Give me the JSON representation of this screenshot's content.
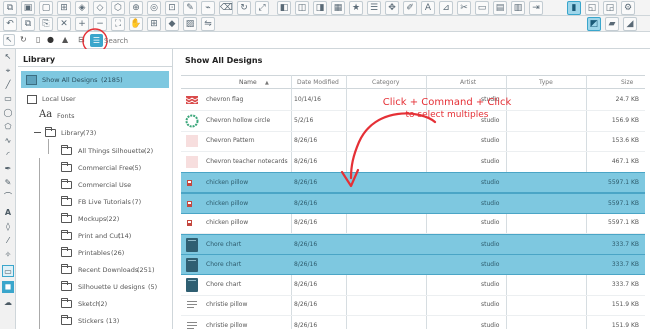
{
  "search": {
    "placeholder": "Search"
  },
  "library": {
    "title": "Library",
    "items": [
      {
        "label": "Show All Designs",
        "count": "(2185)"
      },
      {
        "label": "Local User",
        "count": ""
      },
      {
        "label": "Fonts",
        "count": ""
      },
      {
        "label": "Library",
        "count": "(73)"
      },
      {
        "label": "All Things Silhouette",
        "count": "(2)"
      },
      {
        "label": "Commercial Free",
        "count": "(5)"
      },
      {
        "label": "Commercial Use",
        "count": ""
      },
      {
        "label": "FB Live Tutorials",
        "count": "(7)"
      },
      {
        "label": "Mockups",
        "count": "(22)"
      },
      {
        "label": "Print and Cut",
        "count": "(14)"
      },
      {
        "label": "Printables",
        "count": "(26)"
      },
      {
        "label": "Recent Downloads",
        "count": "(251)"
      },
      {
        "label": "Silhouette U designs",
        "count": "(5)"
      },
      {
        "label": "Sketch",
        "count": "(2)"
      },
      {
        "label": "Stickers",
        "count": "(13)"
      }
    ]
  },
  "designs": {
    "title": "Show All Designs",
    "columns": [
      "Name",
      "Date Modified",
      "Category",
      "Artist",
      "Type",
      "Size"
    ],
    "rows": [
      {
        "name": "chevron flag",
        "date": "10/14/16",
        "type": "studio",
        "size": "24.7 KB",
        "selected": false,
        "thumb": "flag"
      },
      {
        "name": "Chevron hollow circle",
        "date": "5/2/16",
        "type": "studio",
        "size": "156.9 KB",
        "selected": false,
        "thumb": "circle"
      },
      {
        "name": "Chevron Pattern",
        "date": "8/26/16",
        "type": "studio",
        "size": "153.6 KB",
        "selected": false,
        "thumb": "blank"
      },
      {
        "name": "Chevron teacher notecards",
        "date": "8/26/16",
        "type": "studio",
        "size": "467.1 KB",
        "selected": false,
        "thumb": "blank"
      },
      {
        "name": "chicken pillow",
        "date": "8/26/16",
        "type": "studio",
        "size": "5597.1 KB",
        "selected": true,
        "thumb": "pillow"
      },
      {
        "name": "chicken pillow",
        "date": "8/26/16",
        "type": "studio",
        "size": "5597.1 KB",
        "selected": true,
        "thumb": "pillow"
      },
      {
        "name": "chicken pillow",
        "date": "8/26/16",
        "type": "studio",
        "size": "5597.1 KB",
        "selected": false,
        "thumb": "pillow"
      },
      {
        "name": "Chore chart",
        "date": "8/26/16",
        "type": "studio",
        "size": "333.7 KB",
        "selected": true,
        "thumb": "chart"
      },
      {
        "name": "Chore chart",
        "date": "8/26/16",
        "type": "studio",
        "size": "333.7 KB",
        "selected": true,
        "thumb": "chart"
      },
      {
        "name": "Chore chart",
        "date": "8/26/16",
        "type": "studio",
        "size": "333.7 KB",
        "selected": false,
        "thumb": "chart"
      },
      {
        "name": "christie pillow",
        "date": "8/26/16",
        "type": "studio",
        "size": "151.9 KB",
        "selected": false,
        "thumb": "text"
      },
      {
        "name": "christie pillow",
        "date": "8/26/16",
        "type": "studio",
        "size": "151.9 KB",
        "selected": false,
        "thumb": "text"
      }
    ]
  },
  "annotation": {
    "line1": "Click + Command + Click",
    "line2": "to select multiples",
    "color": "#e53036"
  },
  "colors": {
    "accent": "#3aa6cc",
    "selection": "#7ec8e0",
    "annotation": "#e53036"
  }
}
